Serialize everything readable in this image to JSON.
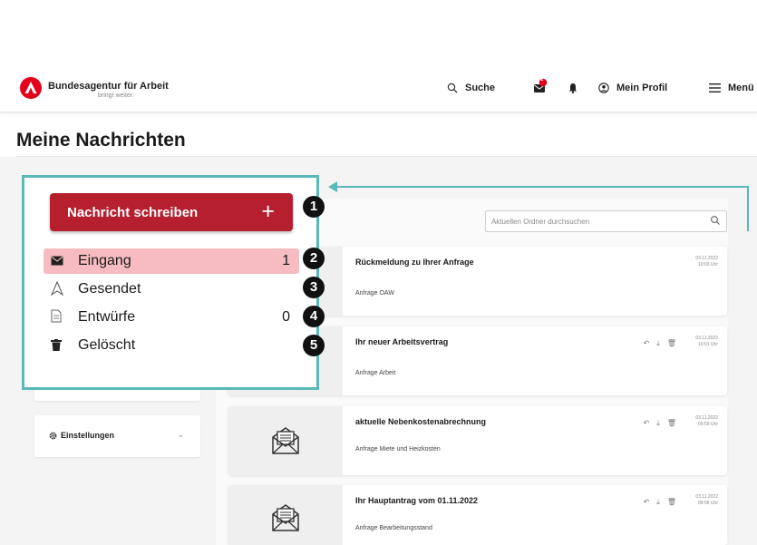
{
  "header": {
    "brand_name": "Bundesagentur für Arbeit",
    "brand_tagline": "bringt weiter.",
    "search_label": "Suche",
    "message_badge": "1",
    "profile_label": "Mein Profil",
    "menu_label": "Menü"
  },
  "page": {
    "title": "Meine Nachrichten"
  },
  "sidebar": {
    "compose_label": "Nachricht schreiben",
    "folders": [
      {
        "label": "Eingang",
        "count": "1"
      },
      {
        "label": "Gesendet",
        "count": ""
      },
      {
        "label": "Entwürfe",
        "count": "0"
      },
      {
        "label": "Gelöscht",
        "count": ""
      }
    ],
    "settings_label": "Einstellungen"
  },
  "search": {
    "placeholder": "Aktuellen Ordner durchsuchen"
  },
  "messages": [
    {
      "subject": "Rückmeldung zu Ihrer Anfrage",
      "preview": "Anfrage OAW",
      "date": "03.11.2022",
      "time": "10:03 Uhr"
    },
    {
      "subject": "Ihr neuer Arbeitsvertrag",
      "preview": "Anfrage Arbeit",
      "date": "03.11.2022",
      "time": "10:01 Uhr"
    },
    {
      "subject": "aktuelle Nebenkostenabrechnung",
      "preview": "Anfrage Miete und Heizkosten",
      "date": "03.11.2022",
      "time": "09:59 Uhr"
    },
    {
      "subject": "Ihr Hauptantrag vom 01.11.2022",
      "preview": "Anfrage Bearbeitungsstand",
      "date": "03.11.2022",
      "time": "09:58 Uhr"
    }
  ],
  "callouts": [
    "1",
    "2",
    "3",
    "4",
    "5"
  ],
  "colors": {
    "brand_red": "#e2001a",
    "compose_red": "#b51f2e",
    "active_folder": "#f6bcc1",
    "annotation_teal": "#5ab8b9"
  }
}
